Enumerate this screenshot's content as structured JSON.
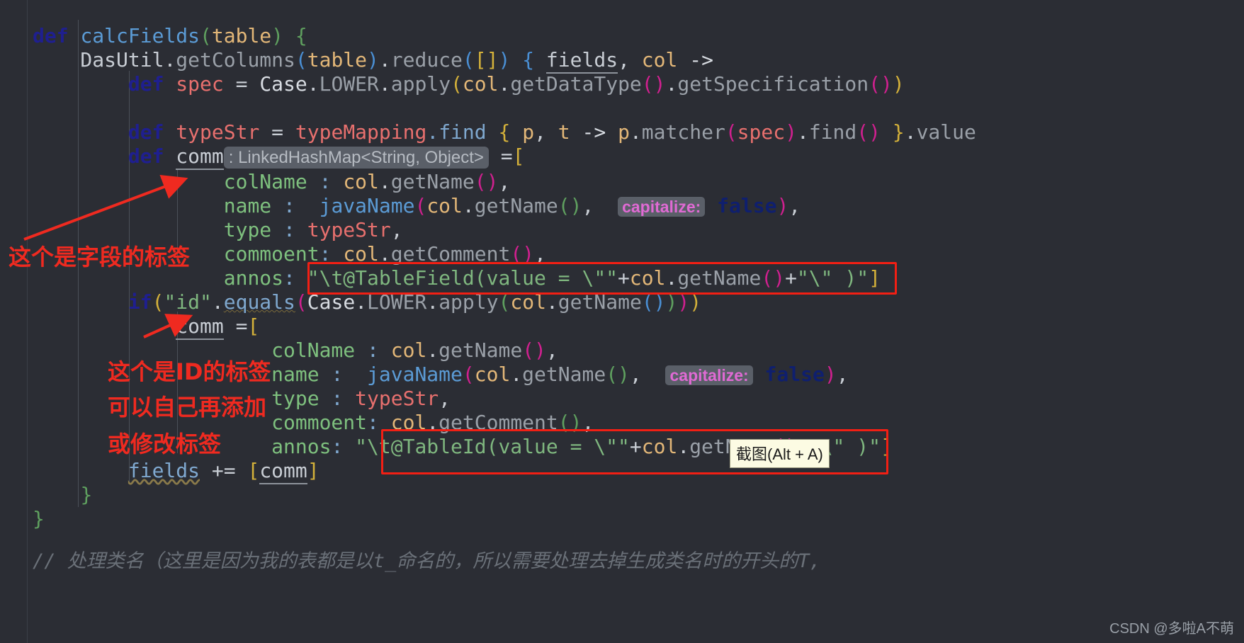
{
  "editor": {
    "background": "#2b2d34",
    "accent_red": "#f21f14",
    "code_lines": [
      {
        "id": "l1",
        "text": "def calcFields(table) {"
      },
      {
        "id": "l2",
        "text": "    DasUtil.getColumns(table).reduce([]) { fields, col ->"
      },
      {
        "id": "l3",
        "text": "        def spec = Case.LOWER.apply(col.getDataType().getSpecification())"
      },
      {
        "id": "l4",
        "text": ""
      },
      {
        "id": "l5",
        "text": "        def typeStr = typeMapping.find { p, t -> p.matcher(spec).find() }.value"
      },
      {
        "id": "l6",
        "text": "        def comm : LinkedHashMap<String, Object> =["
      },
      {
        "id": "l7",
        "text": "                colName : col.getName(),"
      },
      {
        "id": "l8",
        "text": "                name :  javaName(col.getName(),  capitalize: false),"
      },
      {
        "id": "l9",
        "text": "                type : typeStr,"
      },
      {
        "id": "l10",
        "text": "                commoent: col.getComment(),"
      },
      {
        "id": "l11",
        "text": "                annos: \"\\t@TableField(value = \\\"\"+col.getName()+\"\\\" )\"]"
      },
      {
        "id": "l12",
        "text": "        if(\"id\".equals(Case.LOWER.apply(col.getName())))"
      },
      {
        "id": "l13",
        "text": "            comm =["
      },
      {
        "id": "l14",
        "text": "                    colName : col.getName(),"
      },
      {
        "id": "l15",
        "text": "                    name :  javaName(col.getName(),  capitalize: false),"
      },
      {
        "id": "l16",
        "text": "                    type : typeStr,"
      },
      {
        "id": "l17",
        "text": "                    commoent: col.getComment(),"
      },
      {
        "id": "l18",
        "text": "                    annos: \"\\t@TableId(value = \\\"\"+col.getName()+\"\\\" )\"]"
      },
      {
        "id": "l19",
        "text": "        fields += [comm]"
      },
      {
        "id": "l20",
        "text": "    }"
      },
      {
        "id": "l21",
        "text": "}"
      }
    ],
    "inlay_hints": [
      {
        "id": "hint-linkedhashmap",
        "text": ": LinkedHashMap<String, Object>"
      },
      {
        "id": "hint-capitalize-1",
        "text": "capitalize:"
      },
      {
        "id": "hint-capitalize-2",
        "text": "capitalize:"
      }
    ],
    "trailing_comment": "// 处理类名（这里是因为我的表都是以t_命名的，所以需要处理去掉生成类名时的开头的T,"
  },
  "tokens": {
    "def": "def",
    "calcFields": "calcFields",
    "table": "table",
    "open_brace": "{",
    "DasUtil": "DasUtil",
    "getColumns": ".getColumns",
    "reduce": ".reduce",
    "empty_list": "[]",
    "fields": "fields",
    "col": "col",
    "arrow": "->",
    "spec": "spec",
    "equals_sign": "=",
    "Case_LOWER_apply": "Case.LOWER.apply",
    "getDataType": "col.getDataType",
    "getSpecification": ".getSpecification",
    "typeStr": "typeStr",
    "typeMapping_find": "typeMapping.find",
    "p": "p",
    "t": "t",
    "matcher": "p.matcher",
    "find": ".find",
    "value": ".value",
    "comm": "comm",
    "colName": "colName",
    "name": "name",
    "javaName": "javaName",
    "type": "type",
    "commoent": "commoent",
    "annos": "annos",
    "false": "false",
    "getName": "col.getName",
    "getComment": "col.getComment",
    "if": "if",
    "id_string": "\"id\"",
    "equals_method": ".equals",
    "tablefield_string": "\"\\t@TableField(value = \\\"\"",
    "tableid_string": "\"\\t@TableId(value = \\\"\"",
    "plus": "+",
    "close_string": "\"\\\" )\"",
    "close_bracket": "]",
    "plus_equals": "+=",
    "comm_bracket": "[comm]"
  },
  "annotations": {
    "label_field": "这个是字段的标签",
    "label_id_line1": "这个是ID的标签",
    "label_id_line2": "可以自己再添加",
    "label_id_line3": "或修改标签"
  },
  "tooltip": {
    "label": "截图(Alt + A)"
  },
  "watermark": {
    "text": "CSDN @多啦A不萌"
  }
}
